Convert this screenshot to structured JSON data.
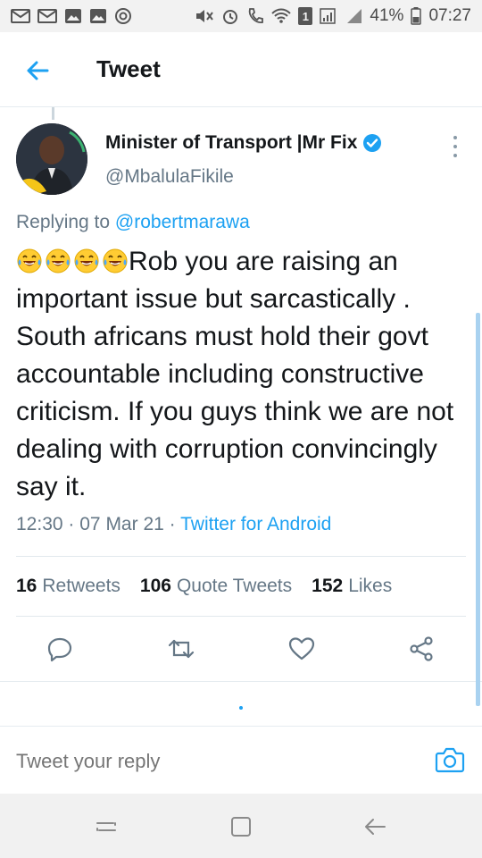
{
  "status_bar": {
    "battery_percent": "41%",
    "time": "07:27",
    "sim_badge": "1",
    "icons_left": [
      "gmail-icon",
      "gmail-icon",
      "gallery-icon",
      "gallery-icon",
      "instagram-icon"
    ],
    "icons_right": [
      "mute-icon",
      "alarm-icon",
      "call-icon",
      "wifi-icon",
      "signal-icon",
      "battery-icon"
    ]
  },
  "app_bar": {
    "title": "Tweet"
  },
  "tweet": {
    "author_name": "Minister of Transport |Mr Fix",
    "author_handle": "@MbalulaFikile",
    "verified": true,
    "replying_label": "Replying to",
    "replying_to": "@robertmarawa",
    "emoji_count": 4,
    "text": "Rob you are raising an important issue  but sarcastically . South africans must hold their govt accountable including constructive criticism. If you guys think we are  not dealing with corruption convincingly say it.",
    "time": "12:30",
    "date": "07 Mar 21",
    "source": "Twitter for Android",
    "separator": "·"
  },
  "stats": {
    "retweets_count": "16",
    "retweets_label": "Retweets",
    "quotes_count": "106",
    "quotes_label": "Quote Tweets",
    "likes_count": "152",
    "likes_label": "Likes"
  },
  "reply": {
    "placeholder": "Tweet your reply"
  },
  "colors": {
    "accent": "#1da1f2",
    "secondary_text": "#657786",
    "primary_text": "#14171a"
  }
}
